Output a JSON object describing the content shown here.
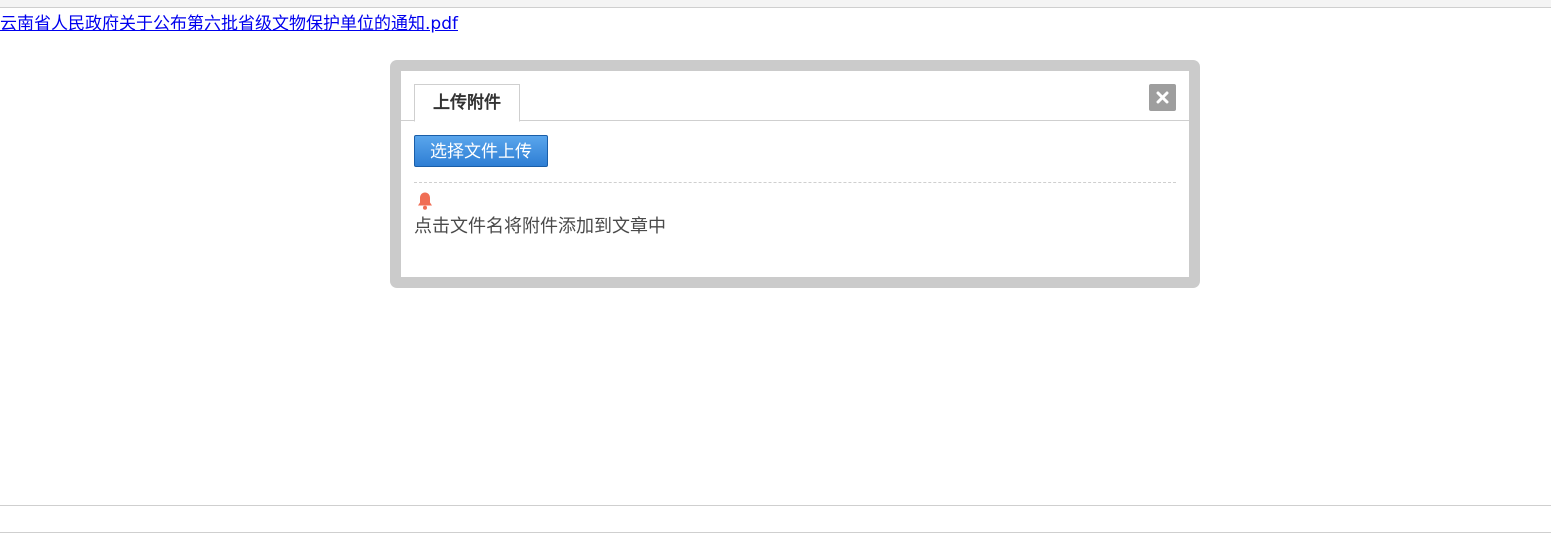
{
  "attachment_link": {
    "text": "云南省人民政府关于公布第六批省级文物保护单位的通知.pdf"
  },
  "dialog": {
    "tab_label": "上传附件",
    "close_icon": "close-icon",
    "upload_button_label": "选择文件上传",
    "hint_icon": "bell-icon",
    "hint_text": "点击文件名将附件添加到文章中"
  },
  "colors": {
    "link": "#0000ee",
    "dialog_frame": "#cbcbcb",
    "upload_button": "#2e7ed4",
    "close_button": "#9e9e9e",
    "bell": "#f06e55"
  }
}
